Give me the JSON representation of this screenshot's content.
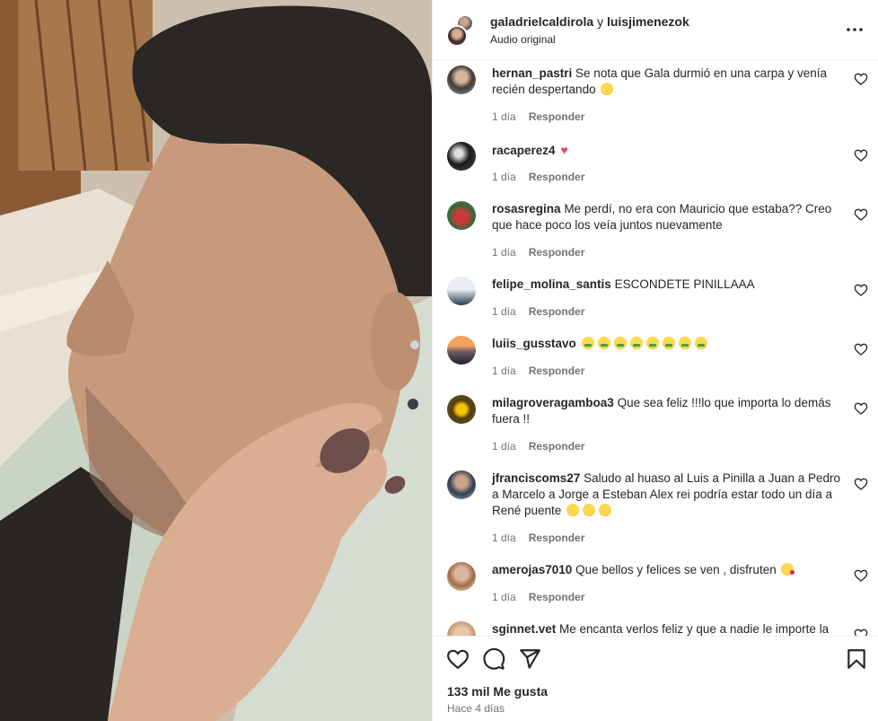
{
  "header": {
    "user1": "galadrielcaldirola",
    "separator": "y",
    "user2": "luisjimenezok",
    "subtitle": "Audio original",
    "more_icon": "more-horizontal-icon"
  },
  "comments": [
    {
      "user": "hernan_pastri",
      "text": "Se nota que Gala durmió en una carpa y venía recién despertando",
      "emojis": [
        "rofl"
      ],
      "age": "1 día",
      "reply": "Responder"
    },
    {
      "user": "racaperez4",
      "text": "",
      "emojis": [
        "heart"
      ],
      "age": "1 día",
      "reply": "Responder"
    },
    {
      "user": "rosasregina",
      "text": "Me perdí, no era con Mauricio que estaba?? Creo que hace poco los veía juntos nuevamente",
      "emojis": [],
      "age": "1 día",
      "reply": "Responder"
    },
    {
      "user": "felipe_molina_santis",
      "text": "ESCONDETE PINILLAAA",
      "emojis": [],
      "age": "1 día",
      "reply": "Responder"
    },
    {
      "user": "luiis_gusstavo",
      "text": "",
      "emojis": [
        "money-mouth",
        "money-mouth",
        "money-mouth",
        "money-mouth",
        "money-mouth",
        "money-mouth",
        "money-mouth",
        "money-mouth"
      ],
      "age": "1 día",
      "reply": "Responder"
    },
    {
      "user": "milagroveragamboa3",
      "text": "Que sea feliz !!!lo que importa lo demás fuera !!",
      "emojis": [],
      "age": "1 día",
      "reply": "Responder"
    },
    {
      "user": "jfranciscoms27",
      "text": "Saludo al huaso al Luis a Pinilla a Juan a Pedro a Marcelo a Jorge a Esteban Alex rei podría estar todo un día a René puente",
      "emojis": [
        "rofl",
        "joy",
        "joy"
      ],
      "age": "1 día",
      "reply": "Responder"
    },
    {
      "user": "amerojas7010",
      "text": "Que bellos y felices se ven , disfruten",
      "emojis": [
        "kiss"
      ],
      "age": "1 día",
      "reply": "Responder"
    },
    {
      "user": "sginnet.vet",
      "text": "Me encanta verlos feliz y que a nadie le importe la",
      "emojis": [],
      "age": "",
      "reply": ""
    }
  ],
  "footer": {
    "likes": "133 mil Me gusta",
    "time": "Hace 4 días",
    "icons": [
      "heart-icon",
      "comment-icon",
      "share-icon",
      "bookmark-icon"
    ]
  },
  "colors": {
    "text": "#262626",
    "secondary": "#737373",
    "heart_emoji": "#ed4956",
    "border": "#efefef"
  }
}
